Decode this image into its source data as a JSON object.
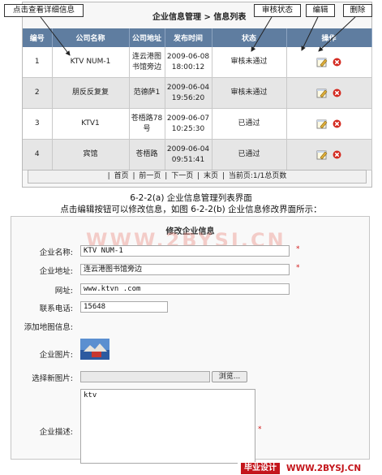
{
  "list": {
    "panel_title": "企业信息管理 > 信息列表",
    "headers": [
      "编号",
      "公司名称",
      "公司地址",
      "发布时间",
      "状态",
      "操作"
    ],
    "rows": [
      {
        "id": "1",
        "name": "KTV NUM-1",
        "address": "连云港图书馆旁边",
        "time": "2009-06-08 18:00:12",
        "status": "审核未通过",
        "status_type": "fail"
      },
      {
        "id": "2",
        "name": "朋反反复复",
        "address": "范德萨1",
        "time": "2009-06-04 19:56:20",
        "status": "审核未通过",
        "status_type": "fail"
      },
      {
        "id": "3",
        "name": "KTV1",
        "address": "苍梧路78号",
        "time": "2009-06-07 10:25:30",
        "status": "已通过",
        "status_type": "ok"
      },
      {
        "id": "4",
        "name": "宾馆",
        "address": "苍梧路",
        "time": "2009-06-04 09:51:41",
        "status": "已通过",
        "status_type": "ok"
      }
    ],
    "pager": {
      "first": "首页",
      "prev": "前一页",
      "next": "下一页",
      "last": "末页",
      "current_label": "当前页:1/1总页数"
    }
  },
  "callouts": {
    "detail": "点击查看详细信息",
    "status": "审核状态",
    "edit": "编辑",
    "delete": "删除"
  },
  "captions": {
    "figure_a": "6-2-2(a) 企业信息管理列表界面",
    "instruction": "点击编辑按钮可以修改信息，如图 6-2-2(b) 企业信息修改界面所示："
  },
  "form": {
    "title": "修改企业信息",
    "watermark": "WWW.2BYSJ.CN",
    "fields": {
      "name_label": "企业名称:",
      "name_value": "KTV NUM-1",
      "address_label": "企业地址:",
      "address_value": "连云港图书馆旁边",
      "website_label": "网址:",
      "website_value": "www.ktvn   .com",
      "phone_label": "联系电话:",
      "phone_value": "15648",
      "map_label": "添加地图信息:",
      "image_label": "企业图片:",
      "new_image_label": "选择新图片:",
      "browse_label": "浏览...",
      "desc_label": "企业描述:",
      "desc_value": "ktv"
    },
    "required_mark": "*"
  },
  "footer_logo": {
    "brand": "毕业设计",
    "url": "WWW.2BYSJ.CN"
  },
  "colors": {
    "header_bg": "#5f7da0",
    "status_fail": "#d21a1a",
    "status_ok": "#1a9a1a",
    "logo_red": "#c4161c"
  }
}
